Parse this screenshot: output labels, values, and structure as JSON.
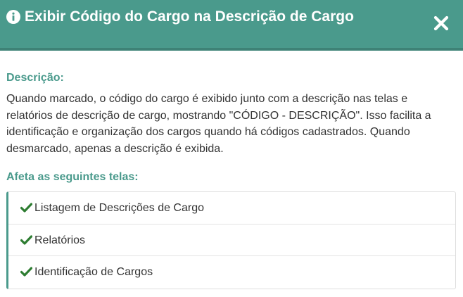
{
  "header": {
    "title": "Exibir Código do Cargo na Descrição de Cargo",
    "info_icon": "info-circle-icon",
    "close_icon": "close-icon",
    "background_color": "#4a9a8c"
  },
  "description": {
    "title": "Descrição:",
    "text": "Quando marcado, o código do cargo é exibido junto com a descrição nas telas e relatórios de descrição de cargo, mostrando \"CÓDIGO - DESCRIÇÃO\". Isso facilita a identificação e organização dos cargos quando há códigos cadastrados. Quando desmarcado, apenas a descrição é exibida."
  },
  "affected": {
    "title": "Afeta as seguintes telas:",
    "items": [
      {
        "label": "Listagem de Descrições de Cargo",
        "icon": "check-icon"
      },
      {
        "label": "Relatórios",
        "icon": "check-icon"
      },
      {
        "label": "Identificação de Cargos",
        "icon": "check-icon"
      }
    ]
  },
  "colors": {
    "accent": "#4a9a8c",
    "check": "#2e7d32",
    "text": "#333333"
  }
}
